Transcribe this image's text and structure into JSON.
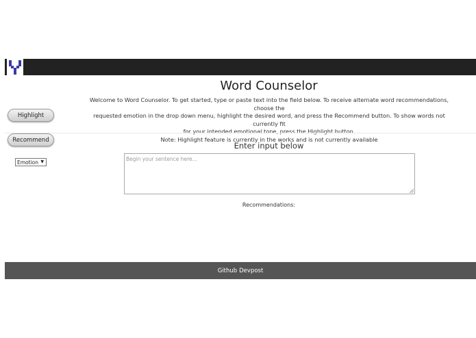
{
  "header": {
    "logo_icon": "y-logo-icon"
  },
  "page": {
    "title": "Word Counselor",
    "intro_lines": [
      "Welcome to Word Counselor. To get started, type or paste text into the field below. To receive alternate word recommendations, choose the",
      "requested emotion in the drop down menu, highlight the desired word, and press the Recommend button. To show words not currently fit",
      "for your intended emotional tone, press the Highlight button.",
      "Note: Highlight feature is currently in the works and is not currently available"
    ]
  },
  "sidebar": {
    "highlight_label": "Highlight",
    "recommend_label": "Recommend",
    "emotion_selected": "Emotion"
  },
  "main": {
    "input_heading": "Enter input below",
    "input_placeholder": "Begin your sentence here...",
    "input_value": "",
    "recommendations_label": "Recommendations:"
  },
  "footer": {
    "links": [
      "Github",
      "Devpost"
    ]
  },
  "colors": {
    "topbar": "#222222",
    "footer": "#555555",
    "logo": "#3a3aa8"
  }
}
